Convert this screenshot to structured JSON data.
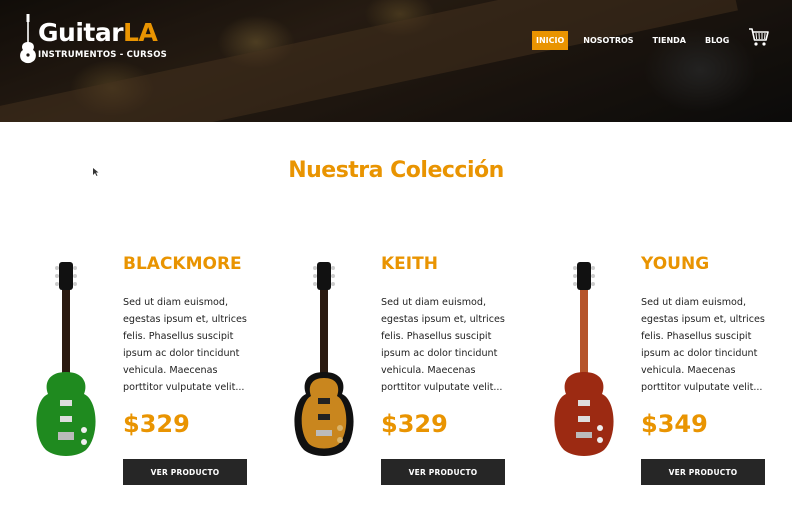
{
  "brand": {
    "title_main": "Guitar",
    "title_accent": "LA",
    "subtitle": "INSTRUMENTOS - CURSOS"
  },
  "nav": {
    "items": [
      {
        "label": "INICIO",
        "active": true
      },
      {
        "label": "NOSOTROS",
        "active": false
      },
      {
        "label": "TIENDA",
        "active": false
      },
      {
        "label": "BLOG",
        "active": false
      }
    ],
    "cart_icon": "cart-icon"
  },
  "collection": {
    "title": "Nuestra Colección"
  },
  "products": [
    {
      "name": "BLACKMORE",
      "description": "Sed ut diam euismod, egestas ipsum et, ultrices felis. Phasellus suscipit ipsum ac dolor tincidunt vehicula. Maecenas porttitor vulputate velit...",
      "price": "$329",
      "button": "VER PRODUCTO",
      "body_color": "#1f8a1f"
    },
    {
      "name": "KEITH",
      "description": "Sed ut diam euismod, egestas ipsum et, ultrices felis. Phasellus suscipit ipsum ac dolor tincidunt vehicula. Maecenas porttitor vulputate velit...",
      "price": "$329",
      "button": "VER PRODUCTO",
      "body_color": "#c9861e"
    },
    {
      "name": "YOUNG",
      "description": "Sed ut diam euismod, egestas ipsum et, ultrices felis. Phasellus suscipit ipsum ac dolor tincidunt vehicula. Maecenas porttitor vulputate velit...",
      "price": "$349",
      "button": "VER PRODUCTO",
      "body_color": "#9c2a12"
    }
  ],
  "colors": {
    "accent": "#e99401",
    "button_bg": "#262626",
    "text": "#222222"
  }
}
